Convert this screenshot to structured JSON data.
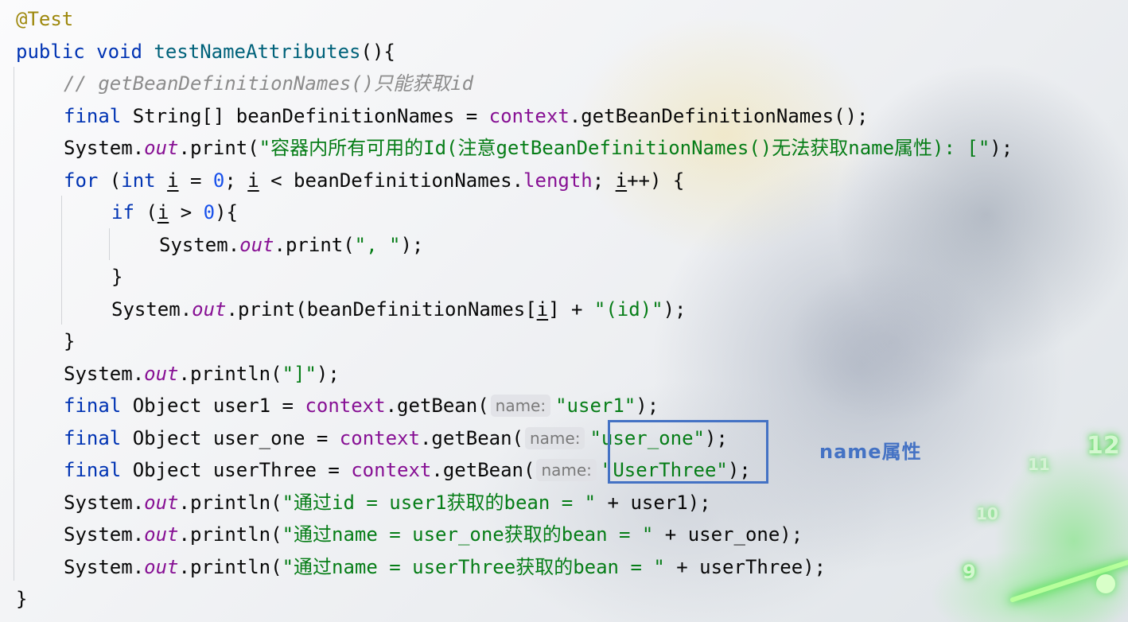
{
  "annotation": {
    "label": "name属性",
    "color": "#4472c4"
  },
  "background": {
    "clock_numbers": [
      "12",
      "11",
      "10",
      "9"
    ]
  },
  "colors": {
    "keyword": "#0033b3",
    "annotation": "#9e880d",
    "method_declaration": "#00627a",
    "comment": "#8c8c8c",
    "string": "#067d17",
    "number": "#1750eb",
    "field": "#871094",
    "parameter_hint_text": "#7a7a7a",
    "text": "#080808"
  },
  "code": {
    "annotation": "@Test",
    "sig_kw": "public void",
    "method_name": "testNameAttributes",
    "sig_rest": "(){",
    "comment": "// getBeanDefinitionNames()只能获取id",
    "l3": {
      "kw": "final",
      "a": " String[] beanDefinitionNames = ",
      "field": "context",
      "b": ".getBeanDefinitionNames();"
    },
    "l4": {
      "a": "System.",
      "field": "out",
      "b": ".print(",
      "str": "\"容器内所有可用的Id(注意getBeanDefinitionNames()无法获取name属性): [\"",
      "c": ");"
    },
    "l5": {
      "kw1": "for",
      "a": " (",
      "kw2": "int",
      "sp": " ",
      "i1": "i",
      "b": " = ",
      "num": "0",
      "c": "; ",
      "i2": "i",
      "d": " < beanDefinitionNames.",
      "field": "length",
      "e": "; ",
      "i3": "i",
      "f": "++) {"
    },
    "l6": {
      "kw": "if",
      "a": " (",
      "i": "i",
      "b": " > ",
      "num": "0",
      "c": "){"
    },
    "l7": {
      "a": "System.",
      "field": "out",
      "b": ".print(",
      "str": "\", \"",
      "c": ");"
    },
    "l8": "}",
    "l9": {
      "a": "System.",
      "field": "out",
      "b": ".print(beanDefinitionNames[",
      "i": "i",
      "c": "] + ",
      "str": "\"(id)\"",
      "d": ");"
    },
    "l10": "}",
    "l11": {
      "a": "System.",
      "field": "out",
      "b": ".println(",
      "str": "\"]\"",
      "c": ");"
    },
    "l12": {
      "kw": "final",
      "a": " Object user1 = ",
      "field": "context",
      "b": ".getBean(",
      "hint": "name:",
      "str": "\"user1\"",
      "c": ");"
    },
    "l13": {
      "kw": "final",
      "a": " Object user_one = ",
      "field": "context",
      "b": ".getBean(",
      "hint": "name:",
      "str": "\"user_one\"",
      "c": ");"
    },
    "l14": {
      "kw": "final",
      "a": " Object userThree = ",
      "field": "context",
      "b": ".getBean(",
      "hint": "name:",
      "str": "\"UserThree\"",
      "c": ");"
    },
    "l15": {
      "a": "System.",
      "field": "out",
      "b": ".println(",
      "str": "\"通过id = user1获取的bean = \"",
      "c": " + user1);"
    },
    "l16": {
      "a": "System.",
      "field": "out",
      "b": ".println(",
      "str": "\"通过name = user_one获取的bean = \"",
      "c": " + user_one);"
    },
    "l17": {
      "a": "System.",
      "field": "out",
      "b": ".println(",
      "str": "\"通过name = userThree获取的bean = \"",
      "c": " + userThree);"
    },
    "l18": "}"
  }
}
